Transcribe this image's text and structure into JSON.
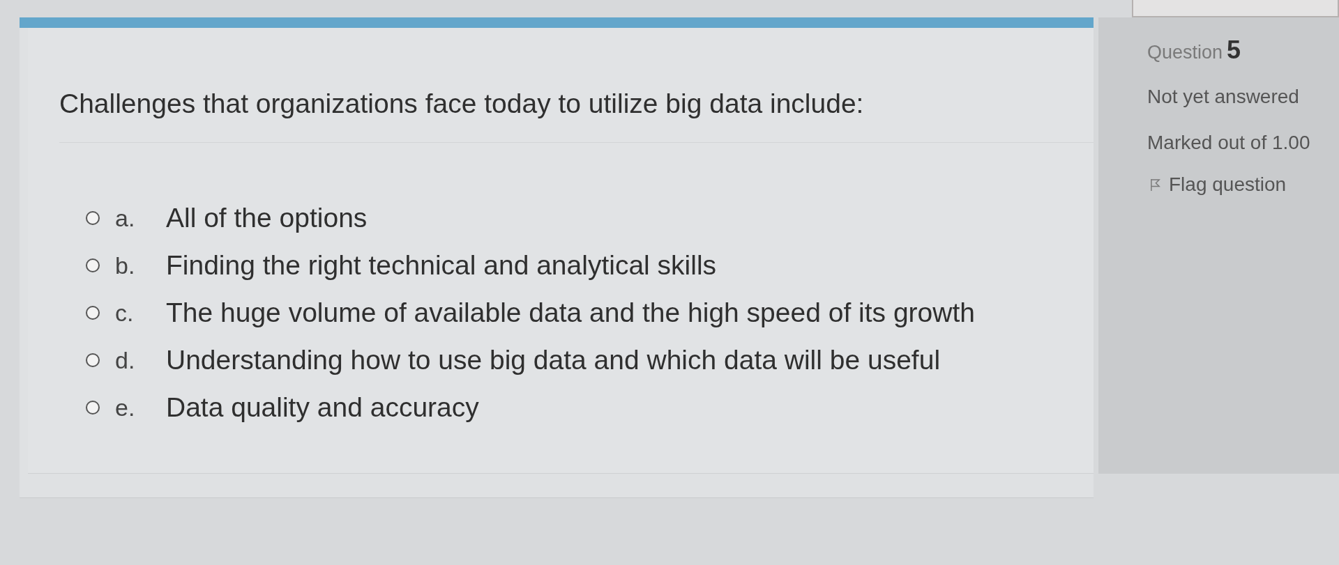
{
  "question": {
    "text": "Challenges that organizations face today to utilize big data include:",
    "options": [
      {
        "letter": "a.",
        "text": "All of the options",
        "selected": false
      },
      {
        "letter": "b.",
        "text": "Finding the right technical and analytical skills",
        "selected": false
      },
      {
        "letter": "c.",
        "text": "The huge volume of available data and the high speed of its growth",
        "selected": false
      },
      {
        "letter": "d.",
        "text": "Understanding how to use big data and which data will be useful",
        "selected": false
      },
      {
        "letter": "e.",
        "text": "Data quality and accuracy",
        "selected": false
      }
    ]
  },
  "question_info": {
    "label": "Question",
    "number": "5",
    "status": "Not yet answered",
    "marks": "Marked out of 1.00",
    "flag": {
      "label": "Flag question",
      "flagged": false
    }
  }
}
